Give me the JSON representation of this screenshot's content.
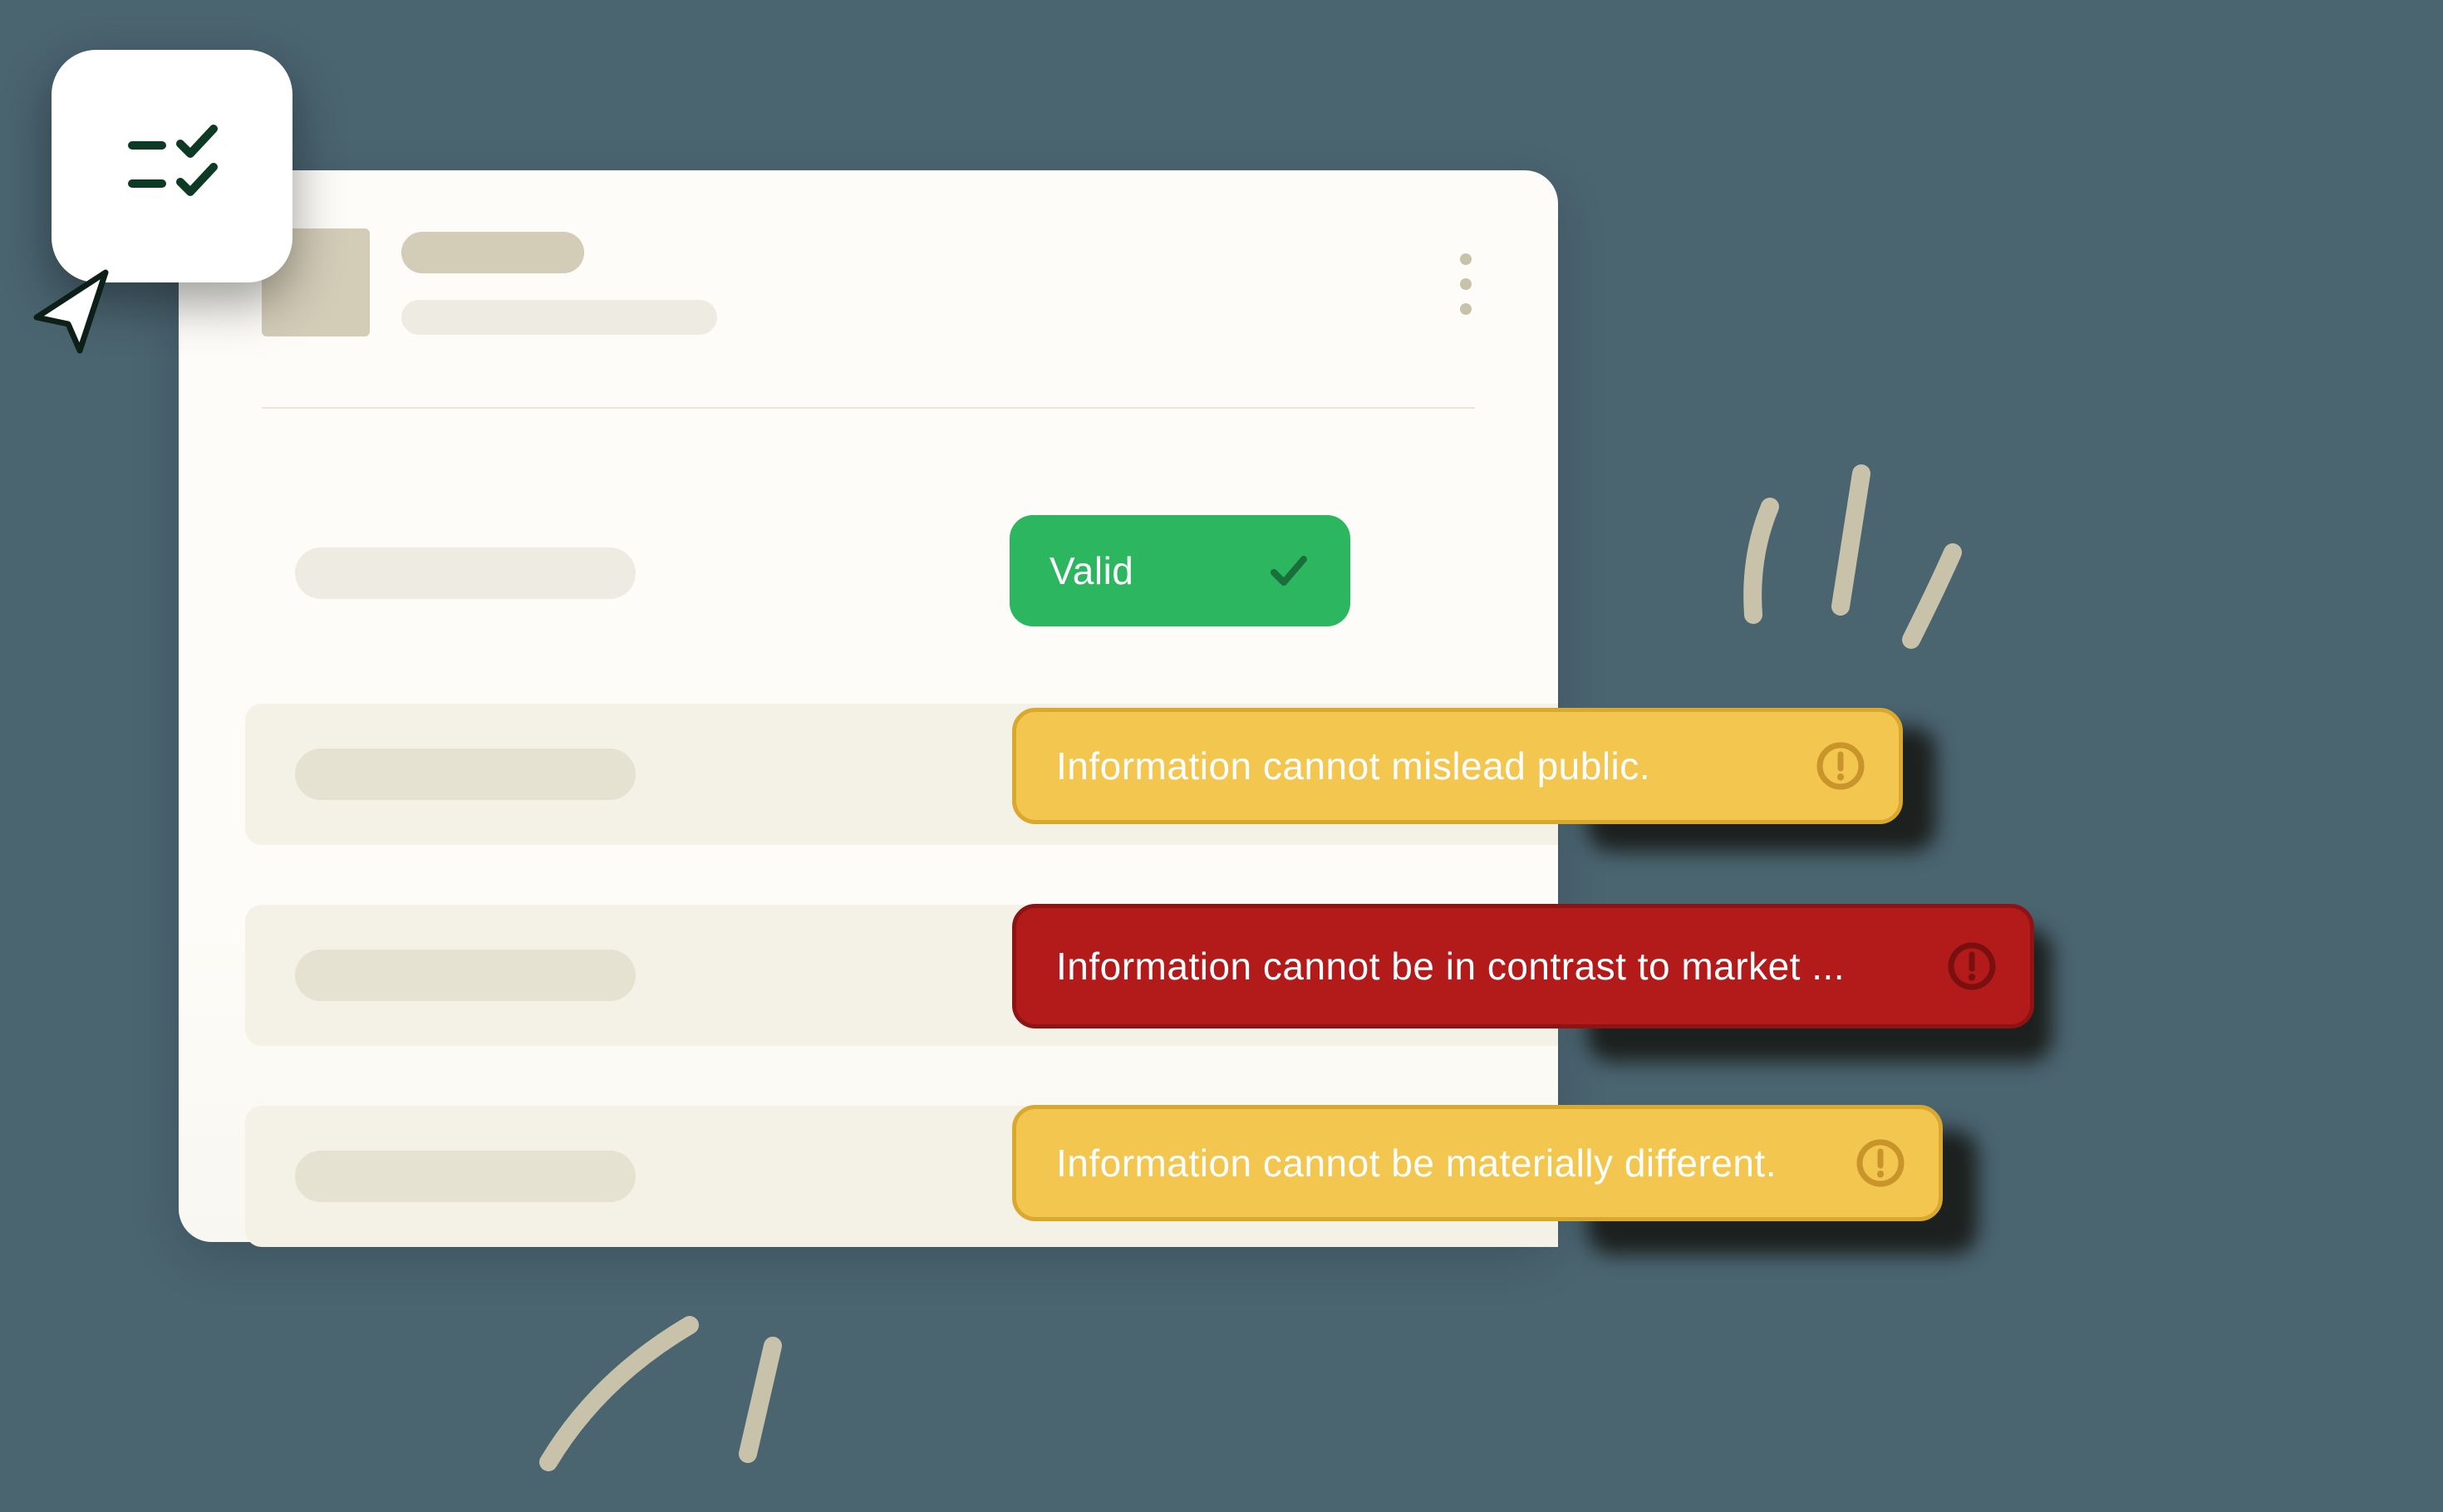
{
  "badges": {
    "valid": {
      "label": "Valid"
    },
    "row2": {
      "label": "Information cannot mislead public."
    },
    "row3": {
      "label": "Information cannot be in contrast to market ..."
    },
    "row4": {
      "label": "Information cannot be materially different."
    }
  },
  "colors": {
    "background": "#4a6470",
    "card": "#fdfcf8",
    "placeholder_strong": "#d3ccb7",
    "placeholder_soft": "#eeece2",
    "row_alt": "#f4f1e7",
    "valid": "#2bb65f",
    "warning": "#f3c64f",
    "error": "#b31b1b",
    "accent_stroke": "#c9c2aa"
  },
  "icons": {
    "widget": "checklist-icon",
    "cursor": "cursor-icon",
    "kebab": "more-vertical-icon",
    "check": "check-icon",
    "alert": "alert-circle-icon"
  }
}
